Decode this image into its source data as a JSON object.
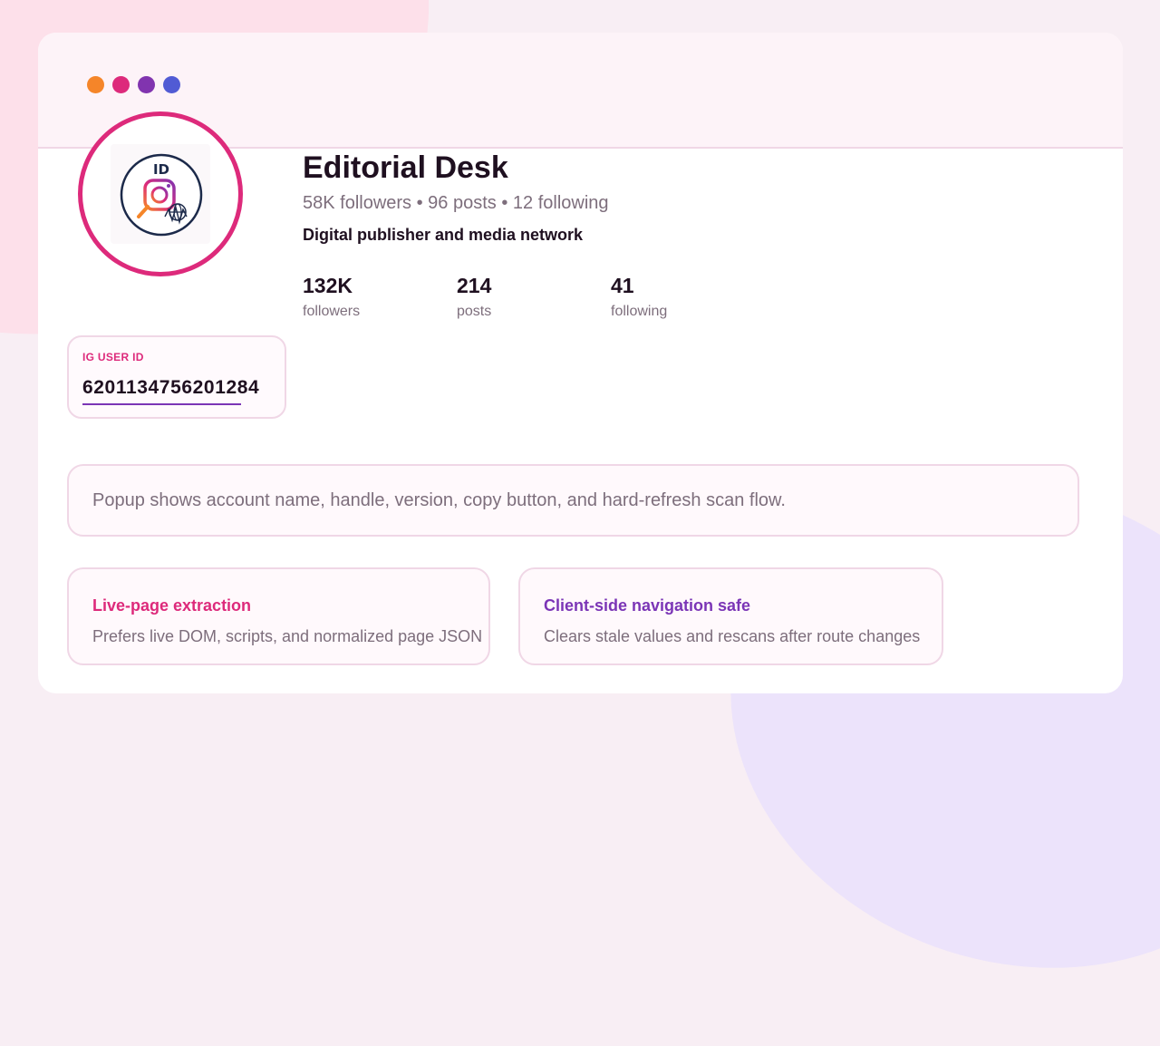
{
  "colors": {
    "accent_pink": "#dd2a7b",
    "accent_purple": "#7b35b6",
    "text_dark": "#1f1020",
    "text_muted": "#7d6e7c",
    "border": "#f0d7e6"
  },
  "window": {
    "dots": [
      {
        "name": "orange-dot",
        "color": "#f58529"
      },
      {
        "name": "pink-dot",
        "color": "#dd2a7b"
      },
      {
        "name": "purple-dot",
        "color": "#8134af"
      },
      {
        "name": "blue-dot",
        "color": "#515bd4"
      }
    ]
  },
  "profile": {
    "avatar_icon": "instagram-id-lookup-icon",
    "avatar_text": "ID",
    "name": "Editorial Desk",
    "meta": "58K followers • 96 posts • 12 following",
    "bio": "Digital publisher and media network"
  },
  "stats": [
    {
      "value": "132K",
      "label": "followers"
    },
    {
      "value": "214",
      "label": "posts"
    },
    {
      "value": "41",
      "label": "following"
    }
  ],
  "user_id_card": {
    "label": "IG USER ID",
    "value": "6201134756201284"
  },
  "note": {
    "text": "Popup shows account name, handle, version, copy button, and hard-refresh scan flow."
  },
  "features": [
    {
      "title": "Live-page extraction",
      "description": "Prefers live DOM, scripts, and normalized page JSON",
      "color": "#dd2a7b"
    },
    {
      "title": "Client-side navigation safe",
      "description": "Clears stale values and rescans after route changes",
      "color": "#7b35b6"
    }
  ]
}
